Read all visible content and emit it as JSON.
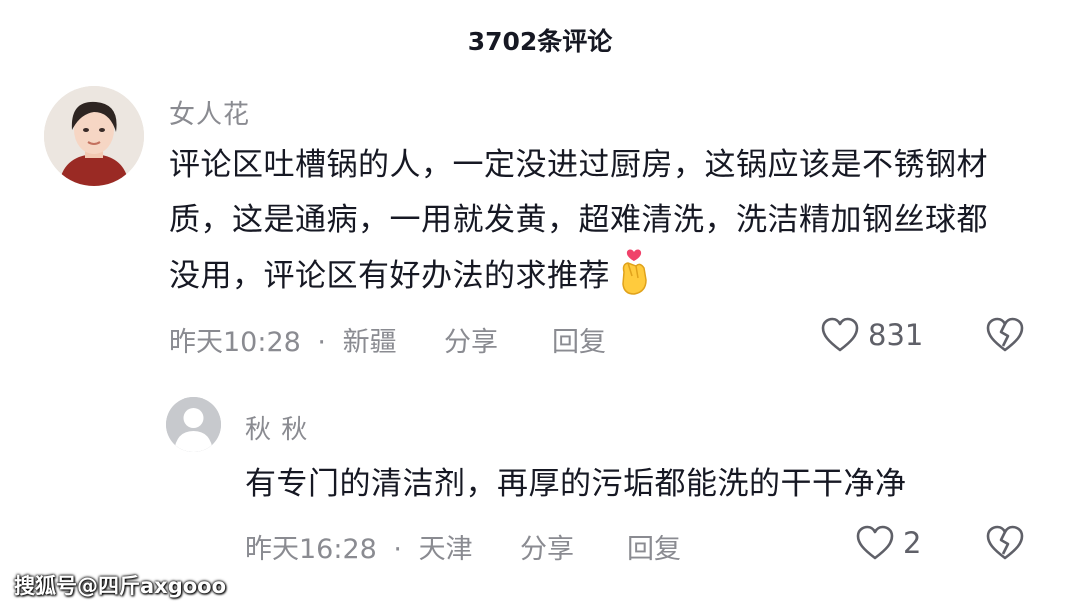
{
  "header": {
    "title": "3702条评论"
  },
  "comments": [
    {
      "username": "女人花",
      "text": "评论区吐槽锅的人，一定没进过厨房，这锅应该是不锈钢材质，这是通病，一用就发黄，超难清洗，洗洁精加钢丝球都没用，评论区有好办法的求推荐",
      "emoji": "finger-heart-emoji",
      "time": "昨天10:28",
      "separator": "·",
      "location": "新疆",
      "share_label": "分享",
      "reply_label": "回复",
      "likes": "831"
    },
    {
      "username": "秋 秋",
      "text": "有专门的清洁剂，再厚的污垢都能洗的干干净净",
      "time": "昨天16:28",
      "separator": "·",
      "location": "天津",
      "share_label": "分享",
      "reply_label": "回复",
      "likes": "2"
    }
  ],
  "watermark": "搜狐号@四斤axgooo",
  "colors": {
    "text": "#161823",
    "secondary": "#8a8b91",
    "background": "#ffffff"
  }
}
